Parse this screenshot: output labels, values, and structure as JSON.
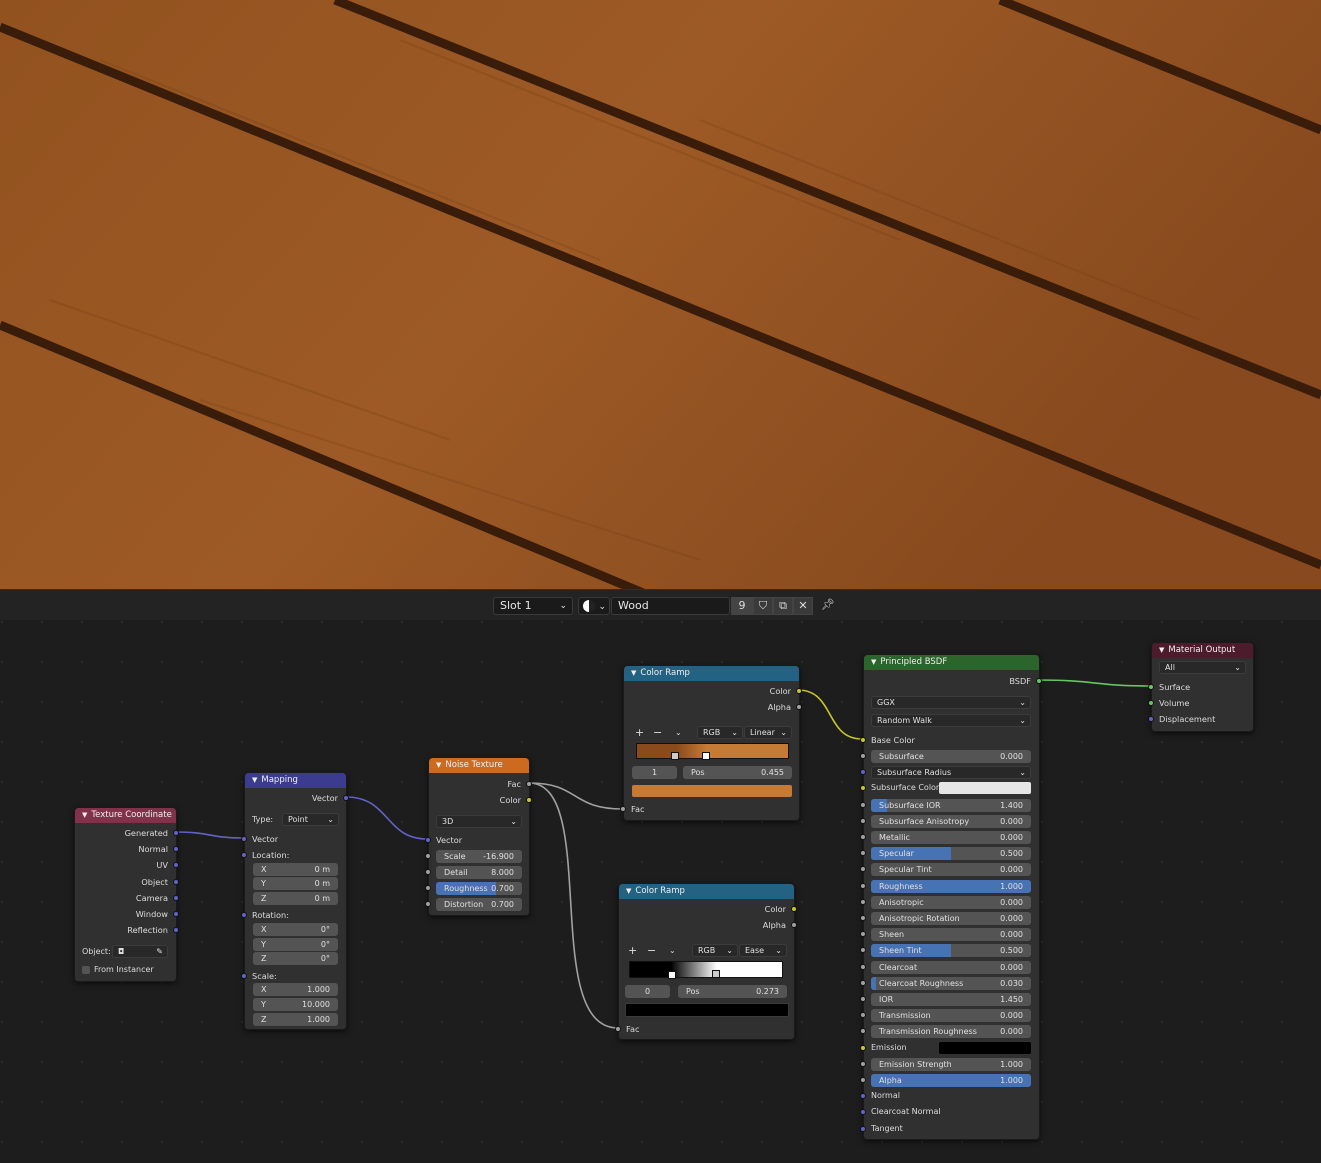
{
  "header": {
    "slot_label": "Slot 1",
    "material_name": "Wood",
    "user_count": "9"
  },
  "colors": {
    "wood_base": "#8a4e22",
    "wood_light": "#a5602a",
    "wood_gap": "#3a1c0b",
    "socket_vector": "#6363c7",
    "socket_color": "#c7c729",
    "socket_float": "#a1a1a1",
    "socket_shader": "#63c763",
    "header_input": "#83314a",
    "header_vector": "#3b3b90",
    "header_texture": "#cc6b1f",
    "header_converter": "#246283",
    "header_shader": "#2b652b",
    "header_output": "#4c1c2c"
  },
  "nodes": {
    "texcoord": {
      "title": "Texture Coordinate",
      "outputs": [
        "Generated",
        "Normal",
        "UV",
        "Object",
        "Camera",
        "Window",
        "Reflection"
      ],
      "object_label": "Object:",
      "from_instancer": "From Instancer"
    },
    "mapping": {
      "title": "Mapping",
      "output": "Vector",
      "type_label": "Type:",
      "type_value": "Point",
      "vector_label": "Vector",
      "location_label": "Location:",
      "location": [
        {
          "axis": "X",
          "value": "0 m"
        },
        {
          "axis": "Y",
          "value": "0 m"
        },
        {
          "axis": "Z",
          "value": "0 m"
        }
      ],
      "rotation_label": "Rotation:",
      "rotation": [
        {
          "axis": "X",
          "value": "0°"
        },
        {
          "axis": "Y",
          "value": "0°"
        },
        {
          "axis": "Z",
          "value": "0°"
        }
      ],
      "scale_label": "Scale:",
      "scale": [
        {
          "axis": "X",
          "value": "1.000"
        },
        {
          "axis": "Y",
          "value": "10.000"
        },
        {
          "axis": "Z",
          "value": "1.000"
        }
      ]
    },
    "noise": {
      "title": "Noise Texture",
      "outputs": [
        "Fac",
        "Color"
      ],
      "dimensions": "3D",
      "vector_label": "Vector",
      "fields": [
        {
          "label": "Scale",
          "value": "-16.900",
          "fill": 0
        },
        {
          "label": "Detail",
          "value": "8.000",
          "fill": 0
        },
        {
          "label": "Roughness",
          "value": "0.700",
          "fill": 0.7
        },
        {
          "label": "Distortion",
          "value": "0.700",
          "fill": 0
        }
      ]
    },
    "ramp1": {
      "title": "Color Ramp",
      "outputs": [
        "Color",
        "Alpha"
      ],
      "color_mode": "RGB",
      "interpolation": "Linear",
      "stop_index": "1",
      "pos_label": "Pos",
      "pos_value": "0.455",
      "stop_color": "#c57a35",
      "input": "Fac"
    },
    "ramp2": {
      "title": "Color Ramp",
      "outputs": [
        "Color",
        "Alpha"
      ],
      "color_mode": "RGB",
      "interpolation": "Ease",
      "stop_index": "0",
      "pos_label": "Pos",
      "pos_value": "0.273",
      "stop_color": "#000000",
      "input": "Fac"
    },
    "bsdf": {
      "title": "Principled BSDF",
      "output": "BSDF",
      "distribution": "GGX",
      "subsurface_method": "Random Walk",
      "base_color_label": "Base Color",
      "subsurface_radius": "Subsurface Radius",
      "subsurface_color": "Subsurface Color",
      "subsurface_color_value": "#e6e6e6",
      "emission_label": "Emission",
      "emission_color_value": "#000000",
      "inputs": [
        {
          "label": "Subsurface",
          "value": "0.000",
          "fill": 0
        },
        {
          "label": "Subsurface IOR",
          "value": "1.400",
          "fill": 0.1
        },
        {
          "label": "Subsurface Anisotropy",
          "value": "0.000",
          "fill": 0
        },
        {
          "label": "Metallic",
          "value": "0.000",
          "fill": 0
        },
        {
          "label": "Specular",
          "value": "0.500",
          "fill": 0.5
        },
        {
          "label": "Specular Tint",
          "value": "0.000",
          "fill": 0
        },
        {
          "label": "Roughness",
          "value": "1.000",
          "fill": 1
        },
        {
          "label": "Anisotropic",
          "value": "0.000",
          "fill": 0
        },
        {
          "label": "Anisotropic Rotation",
          "value": "0.000",
          "fill": 0
        },
        {
          "label": "Sheen",
          "value": "0.000",
          "fill": 0
        },
        {
          "label": "Sheen Tint",
          "value": "0.500",
          "fill": 0.5
        },
        {
          "label": "Clearcoat",
          "value": "0.000",
          "fill": 0
        },
        {
          "label": "Clearcoat Roughness",
          "value": "0.030",
          "fill": 0.03
        },
        {
          "label": "IOR",
          "value": "1.450",
          "fill": 0
        },
        {
          "label": "Transmission",
          "value": "0.000",
          "fill": 0
        },
        {
          "label": "Transmission Roughness",
          "value": "0.000",
          "fill": 0
        }
      ],
      "emission_strength": {
        "label": "Emission Strength",
        "value": "1.000",
        "fill": 0
      },
      "alpha": {
        "label": "Alpha",
        "value": "1.000",
        "fill": 1
      },
      "vectors": [
        "Normal",
        "Clearcoat Normal",
        "Tangent"
      ]
    },
    "output": {
      "title": "Material Output",
      "target": "All",
      "inputs": [
        "Surface",
        "Volume",
        "Displacement"
      ]
    }
  }
}
